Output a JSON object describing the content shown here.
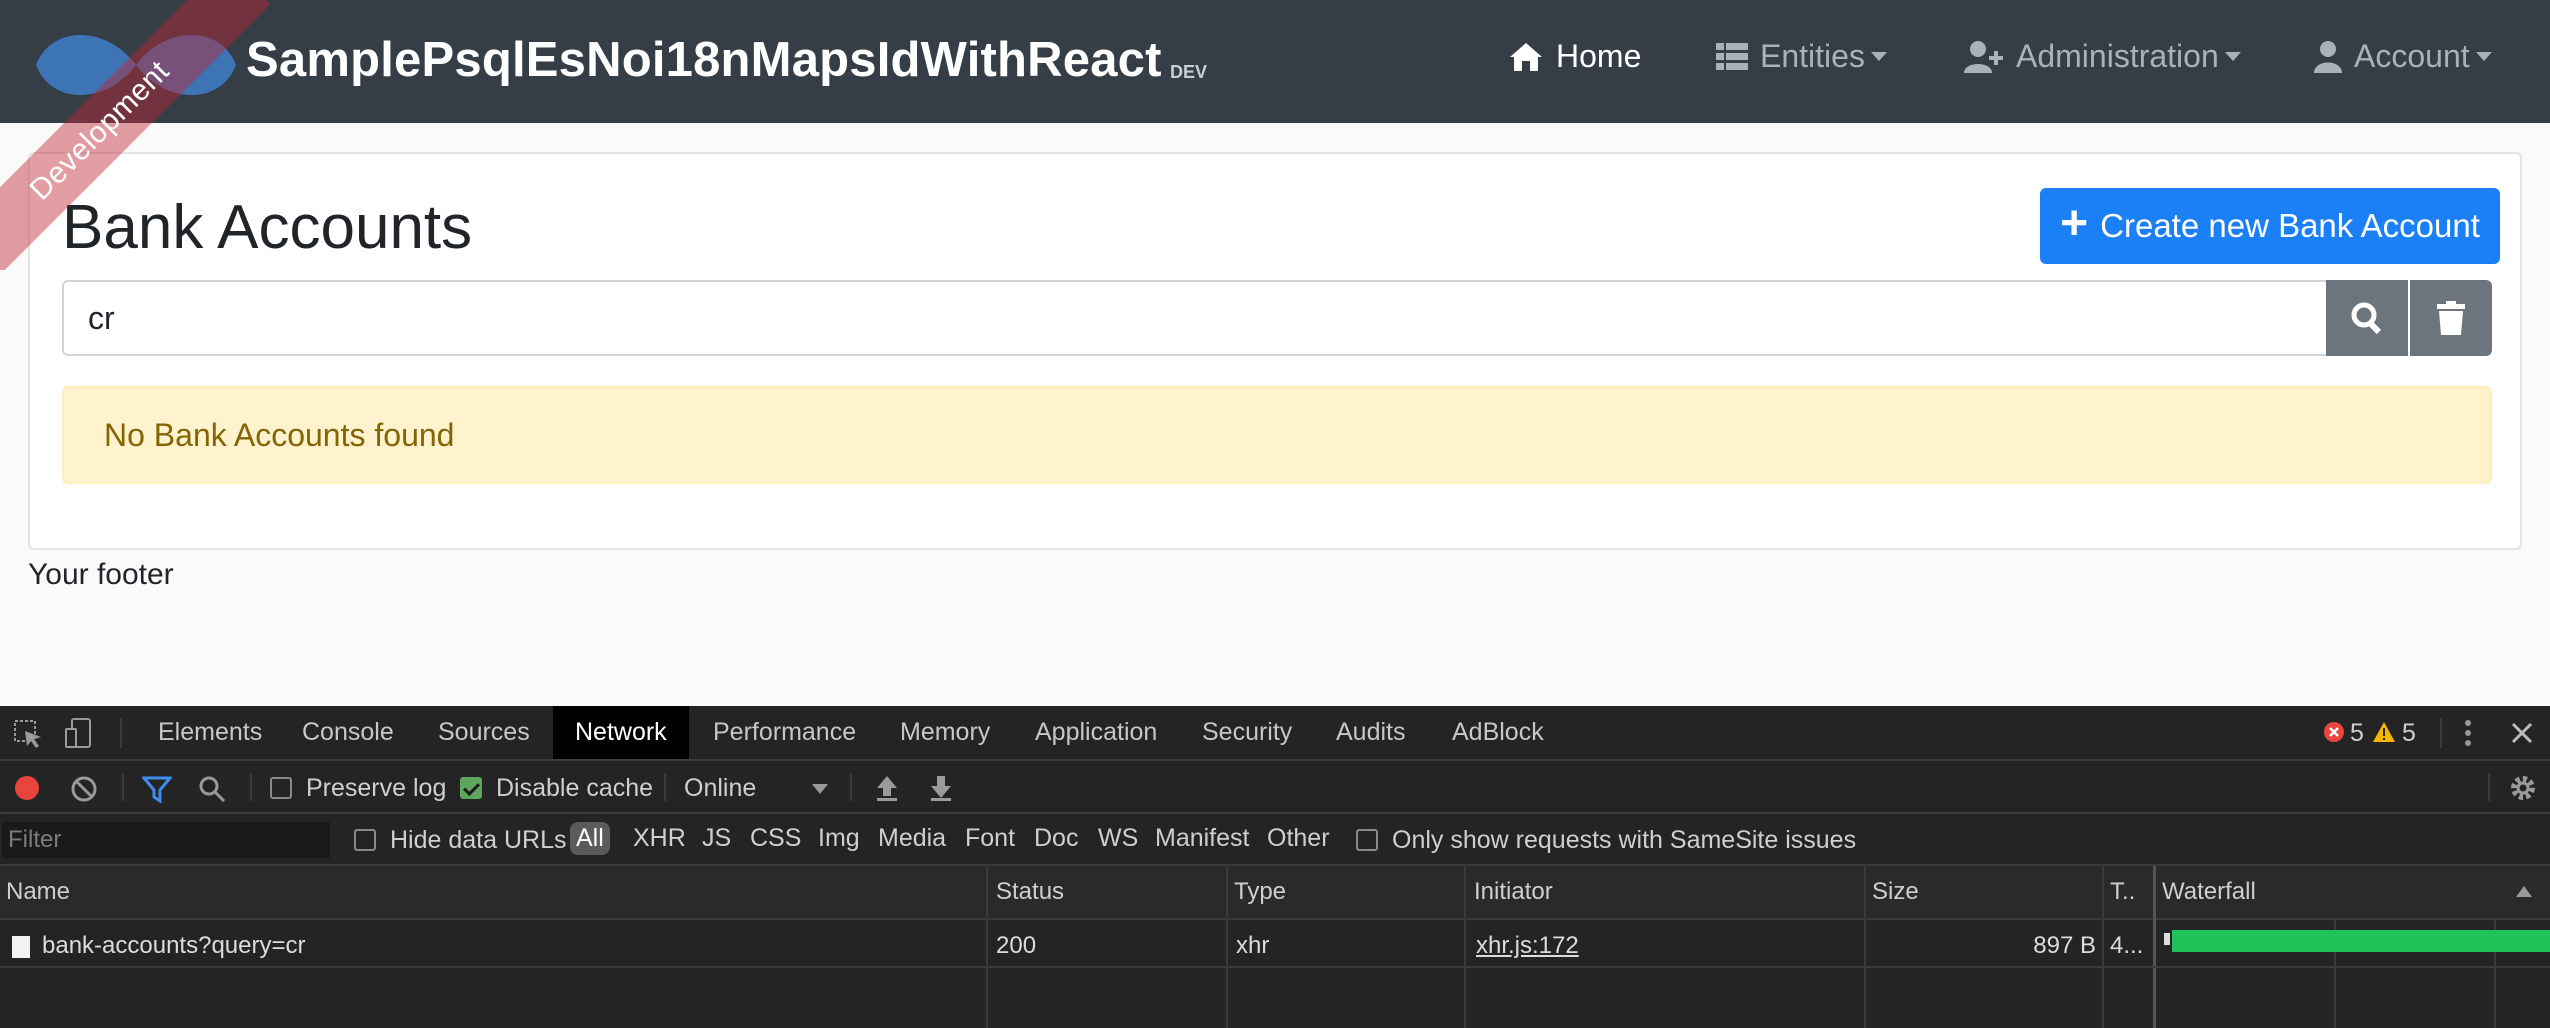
{
  "app": {
    "brand": "SamplePsqlEsNoi18nMapsIdWithReact",
    "env_badge": "DEV",
    "ribbon": "Development"
  },
  "nav": {
    "home": "Home",
    "entities": "Entities",
    "administration": "Administration",
    "account": "Account"
  },
  "page": {
    "title": "Bank Accounts",
    "create_button": "Create new Bank Account",
    "search_value": "cr",
    "empty_message": "No Bank Accounts found",
    "footer": "Your footer"
  },
  "devtools": {
    "tabs": [
      "Elements",
      "Console",
      "Sources",
      "Network",
      "Performance",
      "Memory",
      "Application",
      "Security",
      "Audits",
      "AdBlock"
    ],
    "active_tab": "Network",
    "error_count": "5",
    "warning_count": "5",
    "preserve_log": "Preserve log",
    "disable_cache": "Disable cache",
    "throttling": "Online",
    "filter_placeholder": "Filter",
    "hide_data_urls": "Hide data URLs",
    "type_filters": [
      "All",
      "XHR",
      "JS",
      "CSS",
      "Img",
      "Media",
      "Font",
      "Doc",
      "WS",
      "Manifest",
      "Other"
    ],
    "samesite": "Only show requests with SameSite issues",
    "columns": {
      "name": "Name",
      "status": "Status",
      "type": "Type",
      "initiator": "Initiator",
      "size": "Size",
      "time": "T..",
      "waterfall": "Waterfall"
    },
    "requests": [
      {
        "name": "bank-accounts?query=cr",
        "status": "200",
        "type": "xhr",
        "initiator": "xhr.js:172",
        "size": "897 B",
        "time": "4..."
      }
    ]
  },
  "colors": {
    "navbar": "#353d47",
    "primary": "#1b7ff5",
    "alert_bg": "#fff3cd",
    "waterfall_bar": "#1ec35a"
  }
}
